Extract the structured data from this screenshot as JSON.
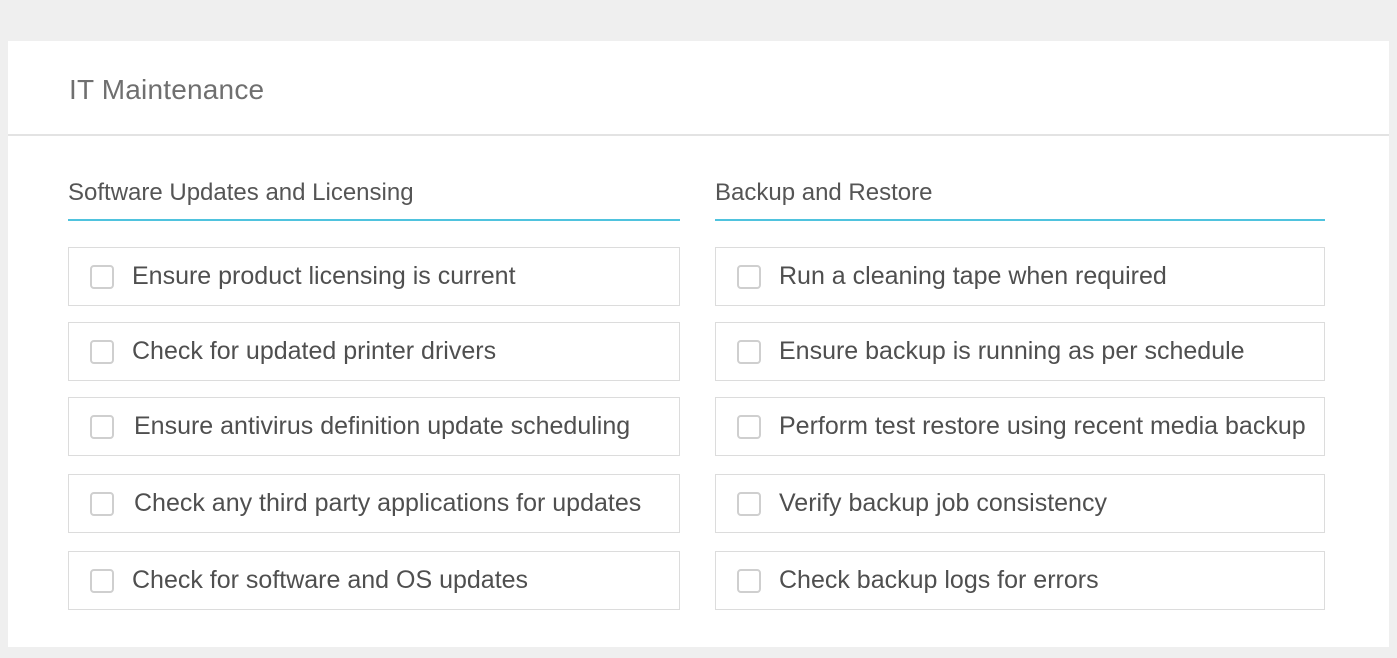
{
  "card": {
    "title": "IT Maintenance"
  },
  "sections": [
    {
      "heading": "Software Updates and Licensing",
      "items": [
        {
          "label": "Ensure product licensing is current",
          "checked": false
        },
        {
          "label": "Check for updated printer drivers",
          "checked": false
        },
        {
          "label": "Ensure antivirus definition update scheduling",
          "checked": false
        },
        {
          "label": "Check any third party applications for updates",
          "checked": false
        },
        {
          "label": "Check for software and OS updates",
          "checked": false
        }
      ]
    },
    {
      "heading": "Backup and Restore",
      "items": [
        {
          "label": "Run a cleaning tape when required",
          "checked": false
        },
        {
          "label": "Ensure backup is running as per schedule",
          "checked": false
        },
        {
          "label": "Perform test restore using recent media backup",
          "checked": false
        },
        {
          "label": "Verify backup job consistency",
          "checked": false
        },
        {
          "label": "Check backup logs for errors",
          "checked": false
        }
      ]
    }
  ],
  "colors": {
    "accent_underline": "#4fc3de",
    "checkbox_border": "#cfcfcf",
    "item_border": "#dcdcdc"
  },
  "icons": {
    "checkbox": "checkbox-unchecked-icon"
  }
}
